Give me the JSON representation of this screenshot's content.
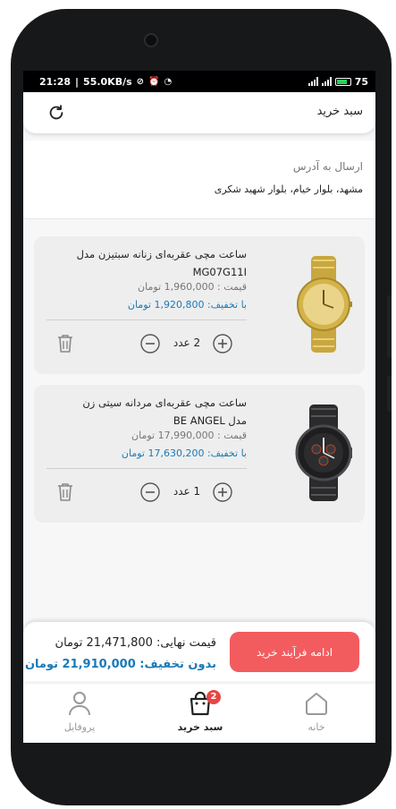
{
  "status_bar": {
    "time": "21:28",
    "speed": "55.0KB/s",
    "battery": "75"
  },
  "header": {
    "title": "سبد خرید",
    "refresh_icon": "refresh-icon"
  },
  "address": {
    "label": "ارسال به آدرس",
    "value": "مشهد، بلوار خیام، بلوار شهید شکری"
  },
  "cart": {
    "items": [
      {
        "name_line1": "ساعت مچی عقربه‌ای زنانه سبتیزن مدل",
        "name_line2": "MG07G11I",
        "price": "قیمت  :  1,960,000 تومان",
        "discount": "با تخفیف:  1,920,800  تومان",
        "quantity": "2 عدد",
        "watch_color": "#d4b34a"
      },
      {
        "name_line1": "ساعت مچی عقربه‌ای مردانه سیتی زن",
        "name_line2": "مدل BE ANGEL",
        "price": "قیمت  :  17,990,000 تومان",
        "discount": "با تخفیف:  17,630,200  تومان",
        "quantity": "1 عدد",
        "watch_color": "#2b2b2d"
      }
    ]
  },
  "summary": {
    "final_price": "قیمت نهایی: 21,471,800 تومان",
    "no_discount_price": "بدون تخفیف: 21,910,000 تومان",
    "checkout_label": "ادامه فرآیند خرید"
  },
  "bottom_nav": {
    "items": [
      {
        "label": "پروفایل",
        "icon": "user-icon"
      },
      {
        "label": "سبد خرید",
        "icon": "cart-bag-icon",
        "badge": "2"
      },
      {
        "label": "خانه",
        "icon": "home-icon"
      }
    ]
  },
  "colors": {
    "accent_red": "#f25c5f",
    "discount_blue": "#1a7ab8",
    "badge_red": "#e84545"
  }
}
